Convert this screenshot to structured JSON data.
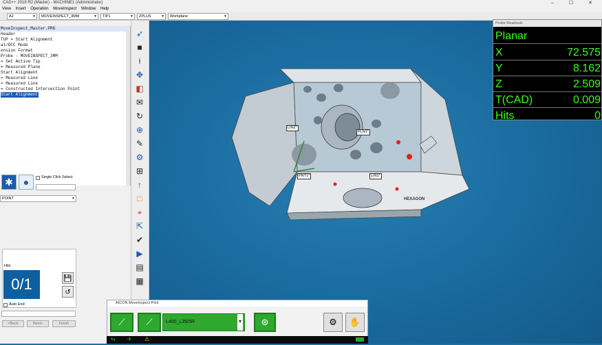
{
  "window": {
    "title": "CAD++ 2018 R2 (Master) - MACHINE1 (Administrator)",
    "controls": "– ☐ ✕"
  },
  "menu": [
    "View",
    "Insert",
    "Operation",
    "MoveInspect",
    "Window",
    "Help"
  ],
  "toolbar": {
    "combo1": "A2",
    "combo2": "MOVEINSPECT_3MM",
    "combo3": "TIP1",
    "combo4": "ZPLUS",
    "combo5": "Workplane"
  },
  "tree": {
    "header": "MoveInspect_Master.PRG",
    "rows": [
      "Header",
      "TUP = Start Alignment",
      "al/DCC Mode",
      "ension Format",
      "Probe - MOVEINSPECT_3MM",
      "= Set Active Tip",
      "= Measured Plane",
      "Start Alignment",
      "= Measured Line",
      "= Measured Line",
      "= Constructed Intersection Point"
    ],
    "selected": "Start Alignment"
  },
  "panel": {
    "single_click": "Single Click Select",
    "feature_type": "POINT"
  },
  "hits": {
    "label": "Hits",
    "count": "0/1",
    "auto_end": "Auto End",
    "back": "<Back",
    "next": "Next>",
    "finish": "Finish"
  },
  "readout": {
    "title": "Probe Readouts",
    "mode": "Planar",
    "rows": [
      {
        "k": "X",
        "v": "72.575"
      },
      {
        "k": "Y",
        "v": "8.162"
      },
      {
        "k": "Z",
        "v": "2.509"
      },
      {
        "k": "T(CAD)",
        "v": "0.009"
      },
      {
        "k": "Hits",
        "v": "0"
      }
    ]
  },
  "cad_labels": {
    "lin2": "LIN2*",
    "pln1": "PLN1*",
    "pnt1": "PNT1*",
    "lin1": "LIN1*",
    "brand": "HEXAGON"
  },
  "pilot": {
    "title": "AICON MoveInspect Pilot",
    "probe": "L400_L35/5R"
  },
  "colors": {
    "accent": "#1c5bad",
    "readout_text": "#39ff14",
    "pilot_green": "#2ea82e",
    "viewport": "#1a6a9e"
  }
}
